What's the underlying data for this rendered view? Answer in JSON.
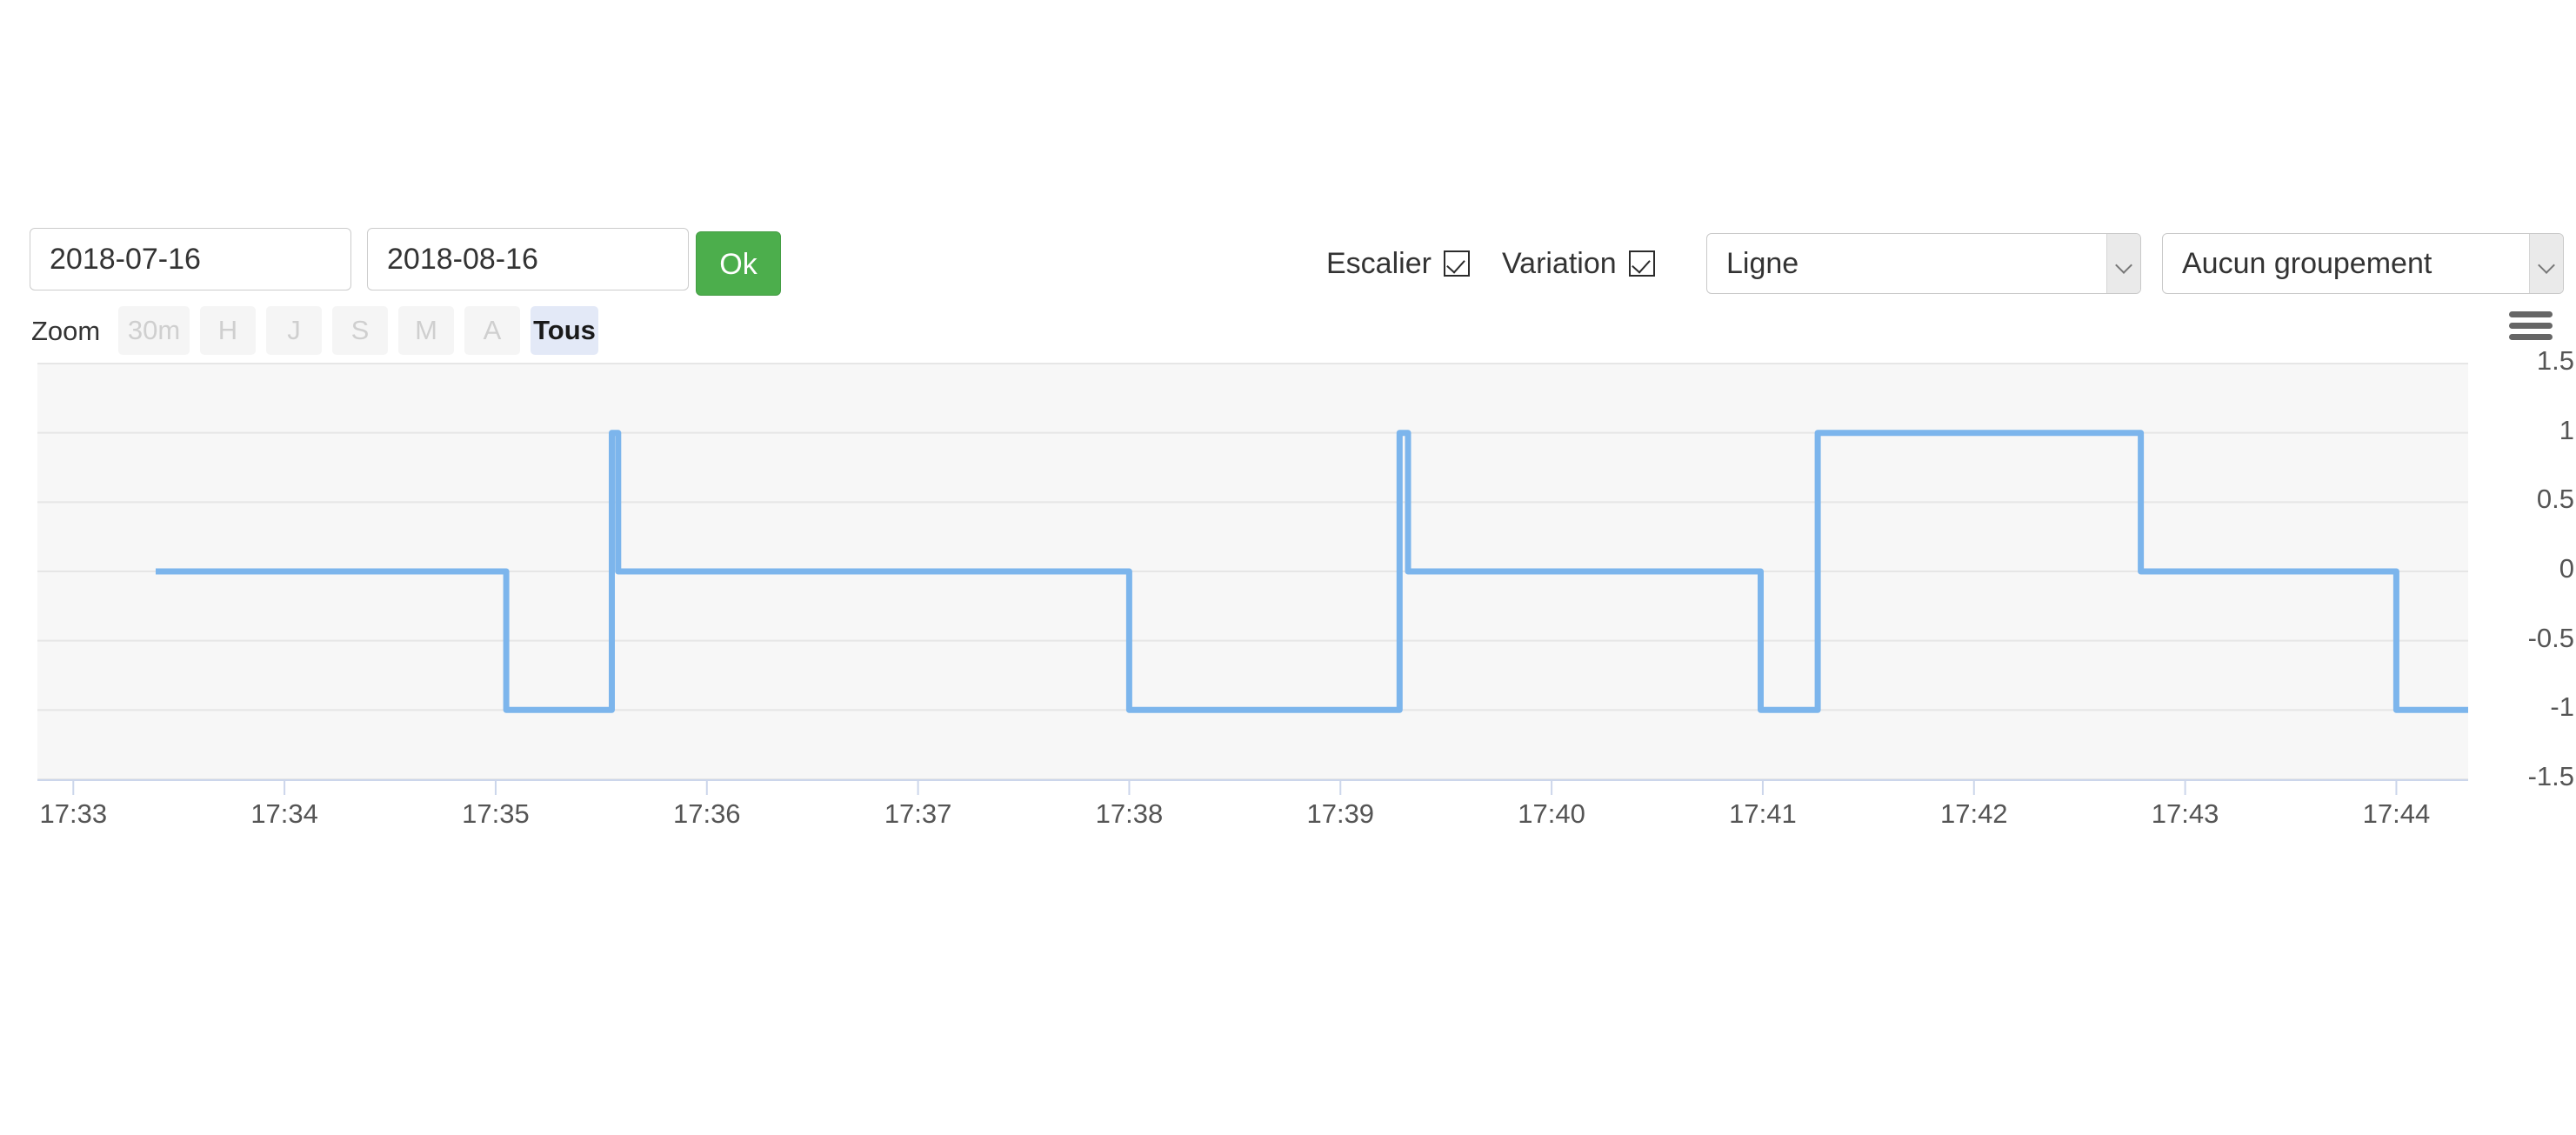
{
  "toolbar": {
    "date_start_value": "2018-07-16",
    "date_start_placeholder": "2018-07-16",
    "date_end_value": "2018-08-16",
    "date_end_placeholder": "2018-08-16",
    "ok_label": "Ok",
    "escalier_label": "Escalier",
    "escalier_checked": "true",
    "variation_label": "Variation",
    "variation_checked": "true",
    "chart_type_selected": "Ligne",
    "grouping_selected": "Aucun groupement",
    "menu_icon": "hamburger-menu-icon"
  },
  "zoom": {
    "label": "Zoom",
    "buttons": [
      {
        "label": "30m",
        "active": "false"
      },
      {
        "label": "H",
        "active": "false"
      },
      {
        "label": "J",
        "active": "false"
      },
      {
        "label": "S",
        "active": "false"
      },
      {
        "label": "M",
        "active": "false"
      },
      {
        "label": "A",
        "active": "false"
      },
      {
        "label": "Tous",
        "active": "true"
      }
    ]
  },
  "colors": {
    "line": "#7cb5ec",
    "ok_button": "#4cae4c",
    "plot_background": "#f7f7f7",
    "gridline": "#e6e6e6",
    "active_zoom_button": "#e3e9f7"
  },
  "chart_data": {
    "type": "line",
    "title": "",
    "xlabel": "",
    "ylabel": "",
    "step": "left",
    "grid": "horizontal",
    "legend": "none",
    "ylim": [
      -1.5,
      1.5
    ],
    "ytick_labels": [
      "1.5",
      "1",
      "0.5",
      "0",
      "-0.5",
      "-1",
      "-1.5"
    ],
    "ytick_values": [
      1.5,
      1,
      0.5,
      0,
      -0.5,
      -1,
      -1.5
    ],
    "xtick_labels": [
      "17:33",
      "17:34",
      "17:35",
      "17:36",
      "17:37",
      "17:38",
      "17:39",
      "17:40",
      "17:41",
      "17:42",
      "17:43",
      "17:44"
    ],
    "xlim": [
      "17:32.83",
      "17:44.34"
    ],
    "series": [
      {
        "name": "Variation",
        "color": "#7cb5ec",
        "points": [
          {
            "t": "17:33.39",
            "v": 0
          },
          {
            "t": "17:35.05",
            "v": 0
          },
          {
            "t": "17:35.05",
            "v": -1
          },
          {
            "t": "17:35.55",
            "v": -1
          },
          {
            "t": "17:35.55",
            "v": 1
          },
          {
            "t": "17:35.58",
            "v": 1
          },
          {
            "t": "17:35.58",
            "v": 0
          },
          {
            "t": "17:38.00",
            "v": 0
          },
          {
            "t": "17:38.00",
            "v": -1
          },
          {
            "t": "17:39.28",
            "v": -1
          },
          {
            "t": "17:39.28",
            "v": 1
          },
          {
            "t": "17:39.32",
            "v": 1
          },
          {
            "t": "17:39.32",
            "v": 0
          },
          {
            "t": "17:40.99",
            "v": 0
          },
          {
            "t": "17:40.99",
            "v": -1
          },
          {
            "t": "17:41.26",
            "v": -1
          },
          {
            "t": "17:41.26",
            "v": 1
          },
          {
            "t": "17:42.79",
            "v": 1
          },
          {
            "t": "17:42.79",
            "v": 0
          },
          {
            "t": "17:44.00",
            "v": 0
          },
          {
            "t": "17:44.00",
            "v": -1
          },
          {
            "t": "17:44.34",
            "v": -1
          }
        ]
      }
    ]
  }
}
